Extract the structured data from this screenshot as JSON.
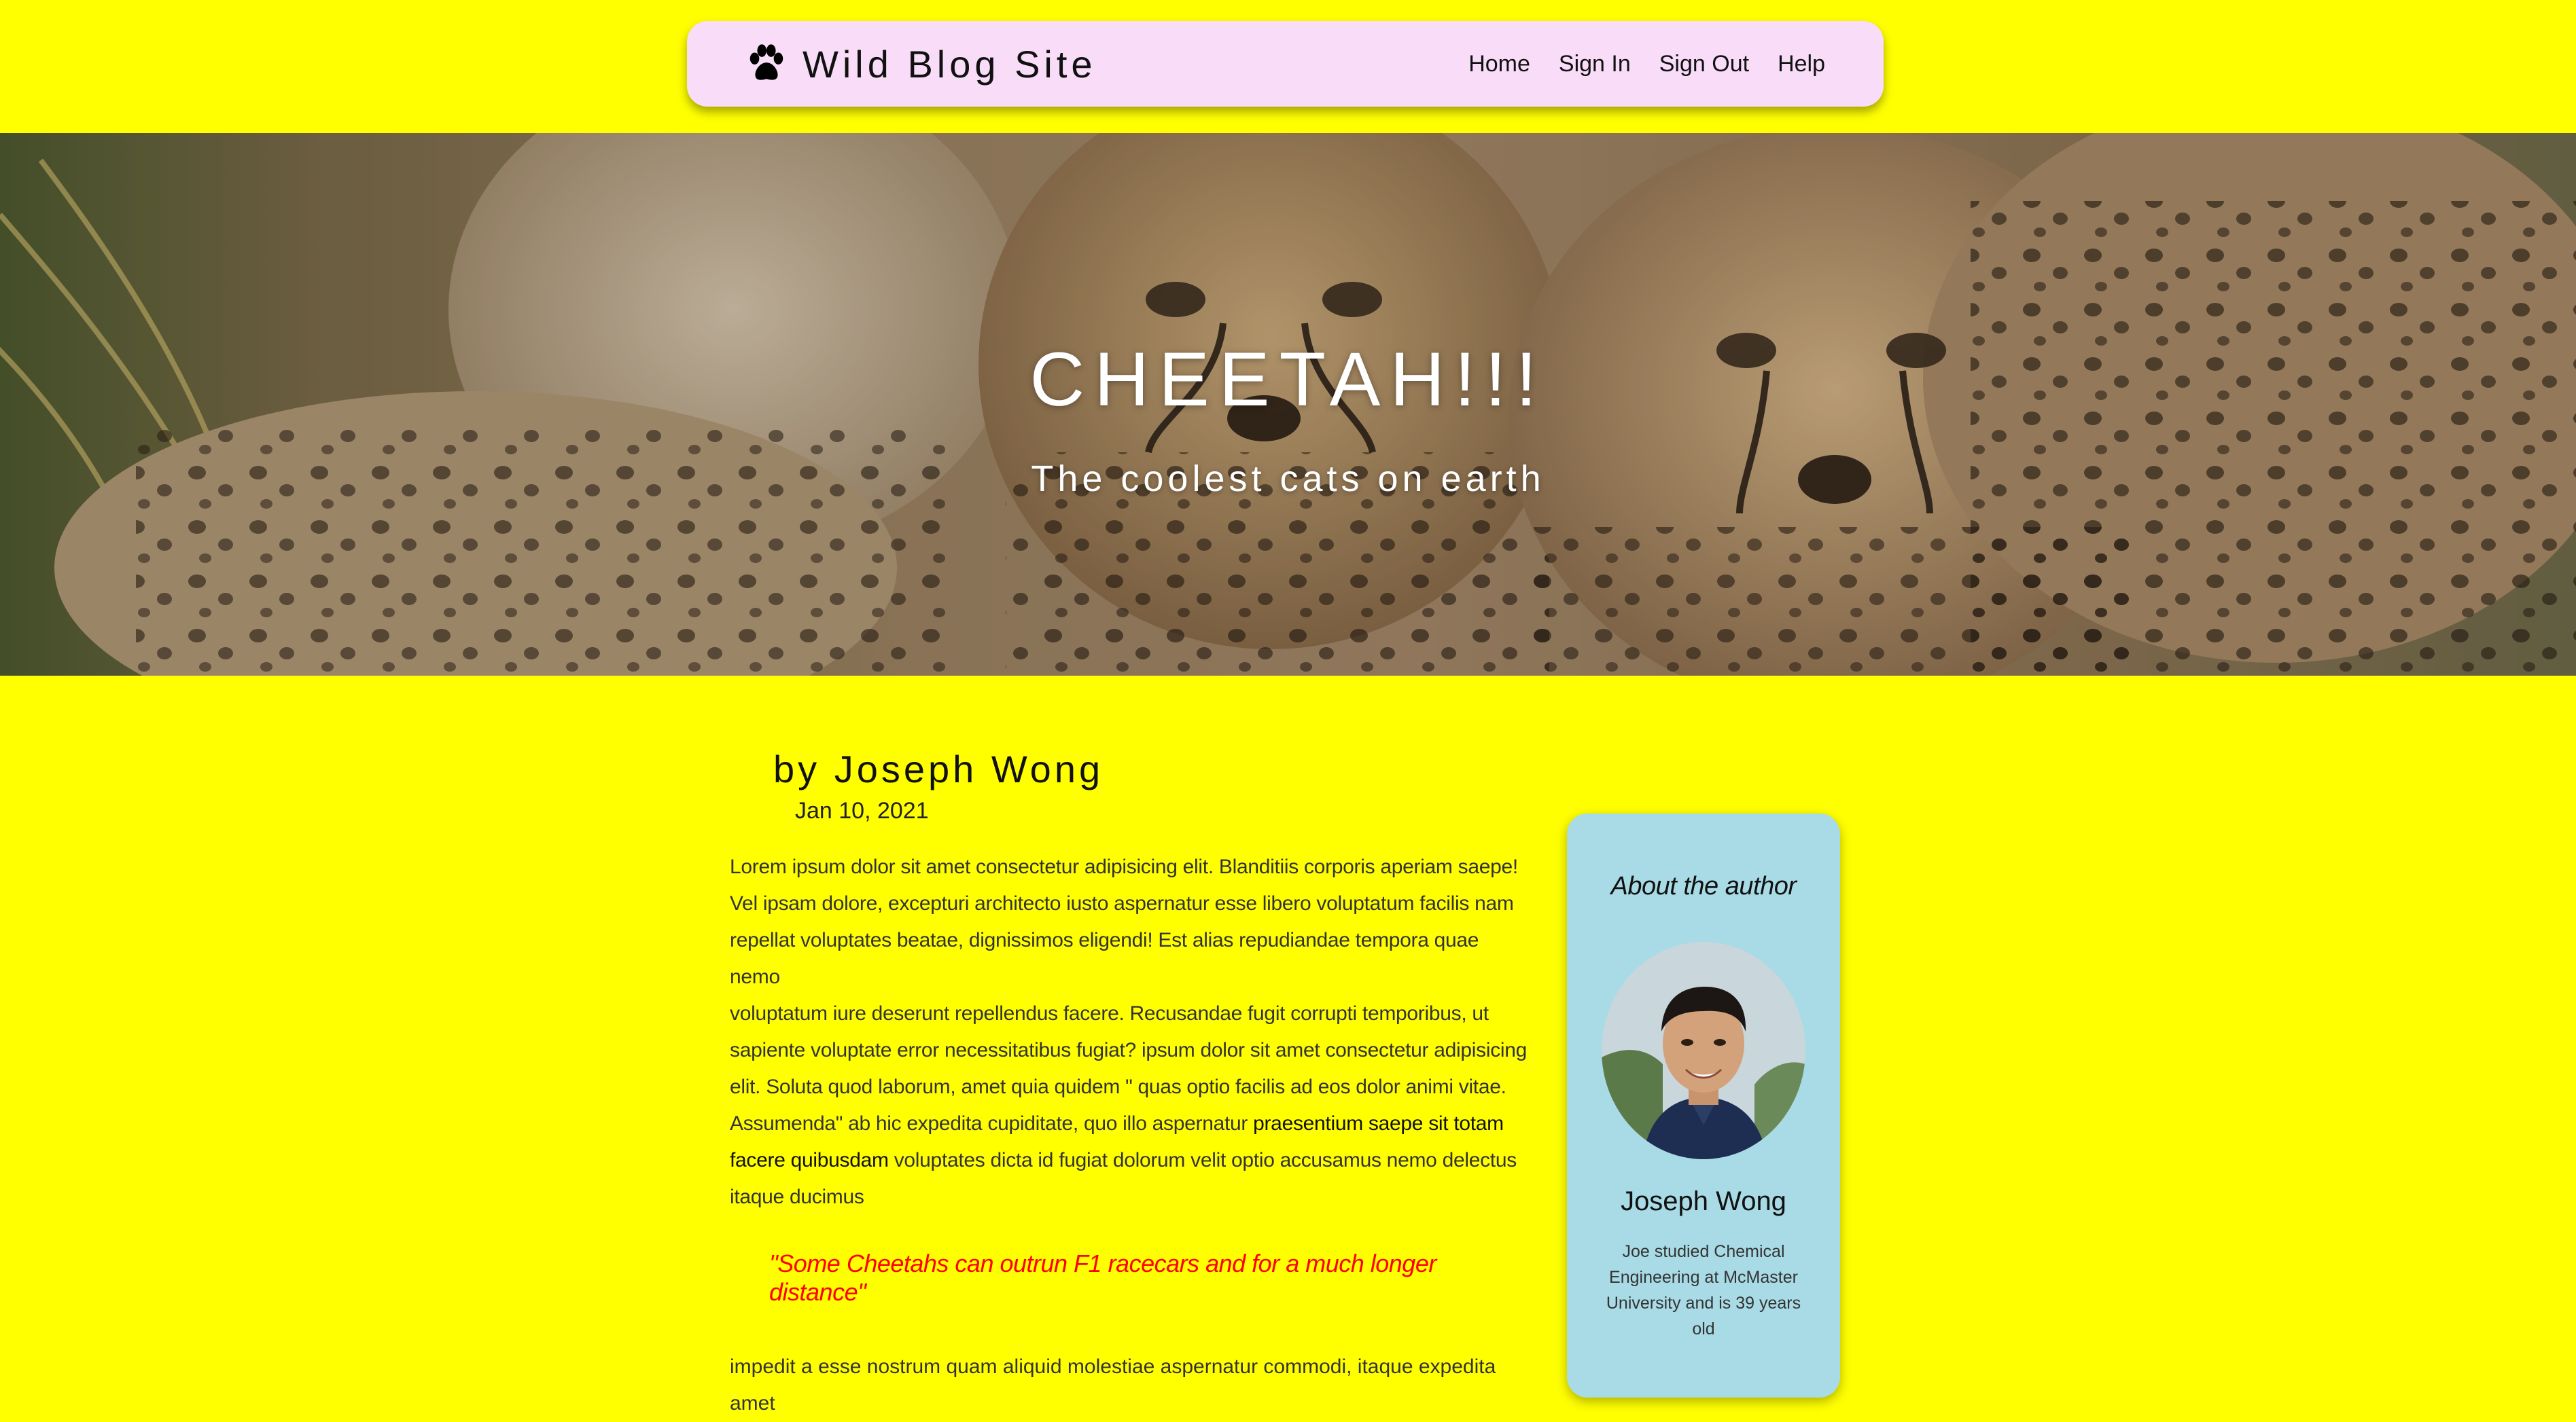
{
  "nav": {
    "brand": "Wild Blog Site",
    "brand_icon": "paw-icon",
    "links": [
      "Home",
      "Sign In",
      "Sign Out",
      "Help"
    ]
  },
  "hero": {
    "title": "CHEETAH!!!",
    "subtitle": "The coolest cats on earth"
  },
  "article": {
    "byline": "by Joseph Wong",
    "date": "Jan 10, 2021",
    "para1_lines": [
      "Lorem ipsum dolor sit amet consectetur adipisicing elit. Blanditiis corporis aperiam saepe!",
      "Vel ipsam dolore, excepturi architecto iusto aspernatur esse libero voluptatum facilis nam",
      "repellat voluptates beatae, dignissimos eligendi! Est alias repudiandae tempora quae nemo",
      "voluptatum iure deserunt repellendus facere. Recusandae fugit corrupti temporibus, ut",
      "sapiente voluptate error necessitatibus fugiat? ipsum dolor sit amet consectetur adipisicing",
      "elit. Soluta quod laborum, amet quia quidem \" quas optio facilis ad eos dolor animi vitae."
    ],
    "para1_line7_start": "Assumenda\" ab hic expedita cupiditate, quo illo aspernatur ",
    "para1_bold_1": "praesentium saepe sit totam",
    "para1_bold_2": "facere quibusdam",
    "para1_line8_end": " voluptates dicta id fugiat dolorum velit optio accusamus nemo delectus",
    "para1_last": "itaque ducimus",
    "quote": "\"Some Cheetahs can outrun F1 racecars and for a much longer distance\"",
    "para2": "impedit a esse nostrum quam aliquid molestiae aspernatur commodi, itaque expedita amet"
  },
  "author_card": {
    "heading": "About the author",
    "name": "Joseph Wong",
    "bio": "Joe studied Chemical Engineering at McMaster University and is 39 years old"
  },
  "colors": {
    "page_bg": "#ffff00",
    "nav_bg": "#f8dcf8",
    "card_bg": "#a8dbe6",
    "quote": "#ff0000"
  }
}
